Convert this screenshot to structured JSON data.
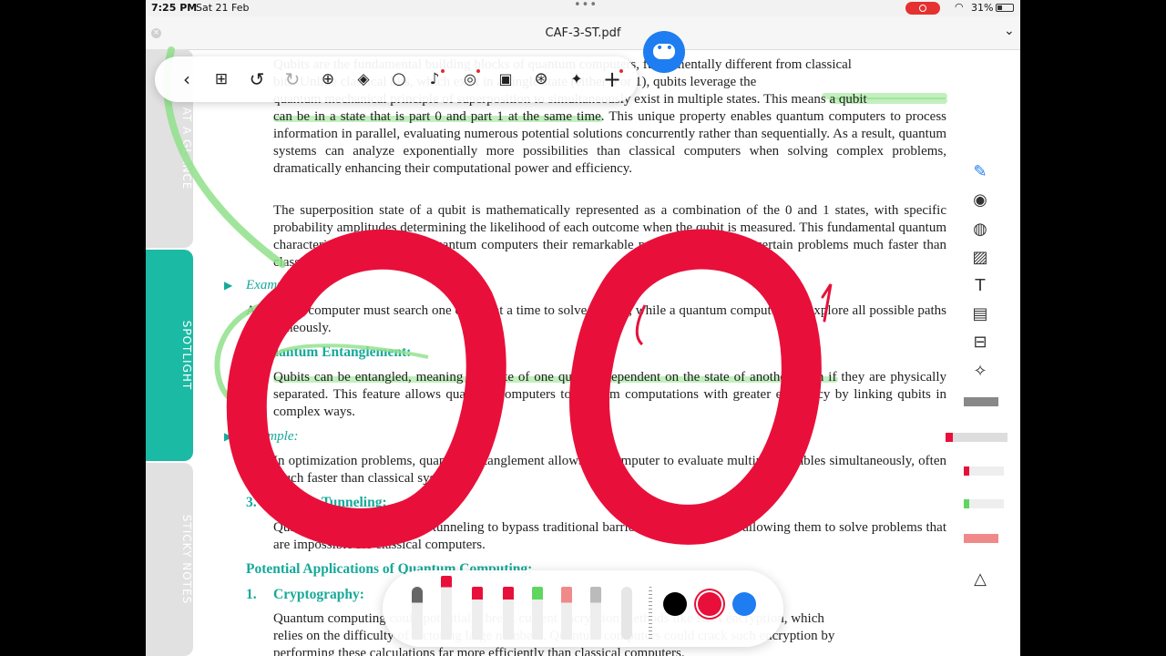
{
  "status": {
    "time": "7:25 PM",
    "date": "Sat 21 Feb",
    "battery": "31%"
  },
  "titlebar": {
    "title": "CAF-3-ST.pdf",
    "close": "×",
    "chevron": "⌄"
  },
  "side_tabs": [
    "AT A GLANCE",
    "SPOTLIGHT",
    "STICKY NOTES"
  ],
  "document": {
    "line0": "Qubits are the fundamental building blocks of quantum computers, fundamentally different from classical",
    "line1": "bits. Unlike classical bits, which exist in a single state (either 0 or 1), qubits leverage the",
    "line2": "quantum mechanical principle of superposition to simultaneously exist in multiple states. This means a qubit",
    "para1_rest": "can be in a state that is part 0 and part 1 at the same time. This unique property enables quantum computers to process information in parallel, evaluating numerous potential solutions concurrently rather than sequentially. As a result, quantum systems can analyze exponentially more possibilities than classical computers when solving complex problems, dramatically enhancing their computational power and efficiency.",
    "para2": "The superposition state of a qubit is mathematically represented as a combination of the 0 and 1 states, with specific probability amplitudes determining the likelihood of each outcome when the qubit is measured. This fundamental quantum characteristic is what gives quantum computers their remarkable potential for solving certain problems much faster than classical computers.",
    "example1_label": "Example:",
    "example1": "A classical computer must search one option at a time to solve a maze, while a quantum computer can explore all possible paths simultaneously.",
    "heading2": "2. Quantum Entanglement:",
    "para3": "Qubits can be entangled, meaning the state of one qubit is dependent on the state of another, even if they are physically separated. This feature allows quantum computers to perform computations with greater efficiency by linking qubits in complex ways.",
    "example2_label": "Example:",
    "para4": "In optimization problems, quantum entanglement allows the computer to evaluate multiple variables simultaneously, often much faster than classical systems.",
    "heading3": "3. Quantum Tunneling:",
    "para5": "Quantum computers can use tunneling to bypass traditional barriers in computations, allowing them to solve problems that are impossible for classical computers.",
    "heading4": "Potential Applications of Quantum Computing:",
    "heading5_num": "1.",
    "heading5": "Cryptography:",
    "para6a": "Quantum computing could potentially break current encryption methods like RSA encryption, which",
    "para6b": "relies on the difficulty of factoring large numbers. Quantum computers could crack such encryption by",
    "para6c": "performing these calculations far more efficiently than classical computers."
  },
  "toolbar": {
    "icons": [
      "chevron-left-icon",
      "grid-icon",
      "undo-icon",
      "redo-icon",
      "add-page-icon",
      "layers-icon",
      "search-icon",
      "microphone-icon",
      "audio-icon",
      "media-icon",
      "globe-icon",
      "magic-icon",
      "plus-icon"
    ]
  },
  "ink": {
    "red": "#e8103a",
    "green": "#8fe08a"
  },
  "dock": {
    "swatches": [
      "#000000",
      "#e8103a",
      "#1e7df0"
    ]
  }
}
